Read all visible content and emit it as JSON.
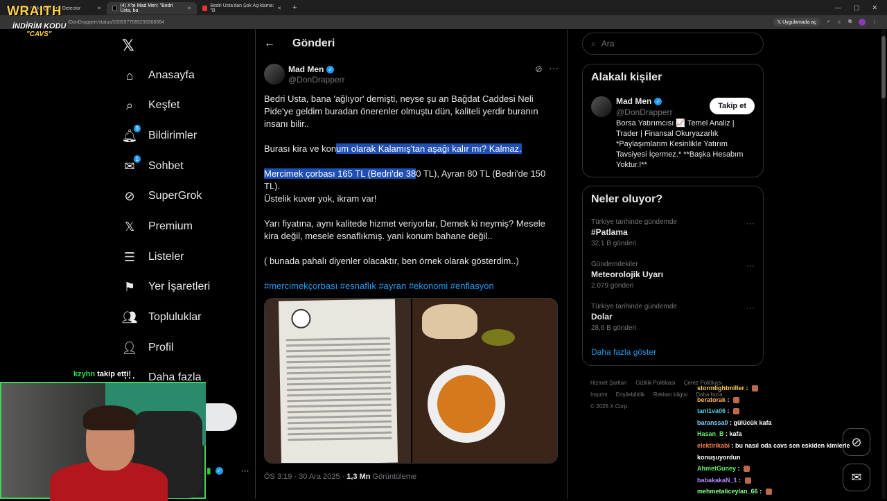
{
  "browser": {
    "tabs": [
      {
        "label": "KickSight Link Detector"
      },
      {
        "label": "(4) X'te Mad Men: \"Bedri Usta, ba"
      },
      {
        "label": "Bedri Usta'dan Şok Açıklama: \"B"
      }
    ],
    "url": "/DonDrapperr/status/2005977085299368364",
    "app_chip": "Uygulamada aç"
  },
  "overlay": {
    "title": "WRAITH",
    "promo": "İNDİRİM KODU",
    "code": "\"CAVS\"",
    "follow_user": "kzyhn",
    "follow_text": "takip etti!"
  },
  "nav": {
    "items": [
      {
        "label": "Anasayfa",
        "icon": "home-icon"
      },
      {
        "label": "Keşfet",
        "icon": "search-icon"
      },
      {
        "label": "Bildirimler",
        "icon": "bell-icon",
        "badge": "3"
      },
      {
        "label": "Sohbet",
        "icon": "mail-icon",
        "badge": "1"
      },
      {
        "label": "SuperGrok",
        "icon": "grok-icon"
      },
      {
        "label": "Premium",
        "icon": "x-icon"
      },
      {
        "label": "Listeler",
        "icon": "list-icon"
      },
      {
        "label": "Yer İşaretleri",
        "icon": "bookmark-icon"
      },
      {
        "label": "Topluluklar",
        "icon": "people-icon"
      },
      {
        "label": "Profil",
        "icon": "user-icon"
      },
      {
        "label": "Daha fazla",
        "icon": "more-icon"
      }
    ],
    "post_pill": "a"
  },
  "post": {
    "header": "Gönderi",
    "author_name": "Mad Men",
    "author_handle": "@DonDrapperr",
    "text1": "Bedri Usta, bana 'ağlıyor' demişti, neyse şu an Bağdat Caddesi Neli Pide'ye geldim buradan önerenler olmuştu dün, kaliteli yerdir buranın insanı bilir..",
    "text2_plain": "Burası kira ve kon",
    "text2_hl": "um olarak Kalamış'tan aşağı kalır mı? Kalmaz.",
    "text3_hl": "Mercimek çorbası 165 TL (Bedri'de 38",
    "text3_plain": "0 TL), Ayran 80 TL (Bedri'de 150 TL).",
    "text4": "Üstelik kuver yok, ikram var!",
    "text5": "Yarı fiyatına, aynı kalitede hizmet veriyorlar, Demek ki neymiş? Mesele kira değil, mesele esnaflıkmış. yani konum bahane değil..",
    "text6": "( bunada pahalı diyenler olacaktır, ben örnek olarak gösterdim..)",
    "hashtags": "#mercimekçorbası #esnaflık #ayran #ekonomi #enflasyon",
    "time": "ÖS 3:19 · 30 Ara 2025 · ",
    "views": "1,3 Mn",
    "views_label": " Görüntüleme"
  },
  "sidebar": {
    "search_placeholder": "Ara",
    "related_title": "Alakalı kişiler",
    "related_name": "Mad Men",
    "related_handle": "@DonDrapperr",
    "follow_label": "Takip et",
    "bio": "Borsa Yatırımcısı 📈 Temel Analiz | Trader | Finansal Okuryazarlık *Paylaşımlarım Kesinlikle Yatırım Tavsiyesi İçermez.* **Başka Hesabım Yoktur.!**",
    "trends_title": "Neler oluyor?",
    "trends": [
      {
        "context": "Türkiye tarihinde gündemde",
        "name": "#Patlama",
        "count": "32,1 B gönderi"
      },
      {
        "context": "Gündemdekiler",
        "name": "Meteorolojik Uyarı",
        "count": "2.079 gönderi"
      },
      {
        "context": "Türkiye tarihinde gündemde",
        "name": "Dolar",
        "count": "28,6 B gönderi"
      }
    ],
    "show_more": "Daha fazla göster",
    "footer": [
      "Hizmet Şartları",
      "Gizlilik Politikası",
      "Çerez Politikası",
      "Imprint",
      "Erişilebilirlik",
      "Reklam bilgisi",
      "Daha fazla ...",
      "© 2026 X Corp."
    ]
  },
  "chat": [
    {
      "user": "stormlightmiller",
      "color": "#ffd24a",
      "msg": ""
    },
    {
      "user": "beratorak",
      "color": "#ffb84d",
      "msg": ""
    },
    {
      "user": "tanl1va06",
      "color": "#4dd0e1",
      "msg": ""
    },
    {
      "user": "baranssa0",
      "color": "#7fd1ff",
      "msg": "gülücük kafa"
    },
    {
      "user": "Hasan_B",
      "color": "#66ee66",
      "msg": "kafa"
    },
    {
      "user": "elektirikabi",
      "color": "#ff7f50",
      "msg": "bu nasıl oda cavs sen eskiden kimlerle konuşuyordun"
    },
    {
      "user": "AhmetGuney",
      "color": "#66ee66",
      "msg": ""
    },
    {
      "user": "babakakaN_1",
      "color": "#b58cff",
      "msg": ""
    },
    {
      "user": "mehmetaliceylan_66",
      "color": "#8aff8a",
      "msg": ""
    }
  ]
}
